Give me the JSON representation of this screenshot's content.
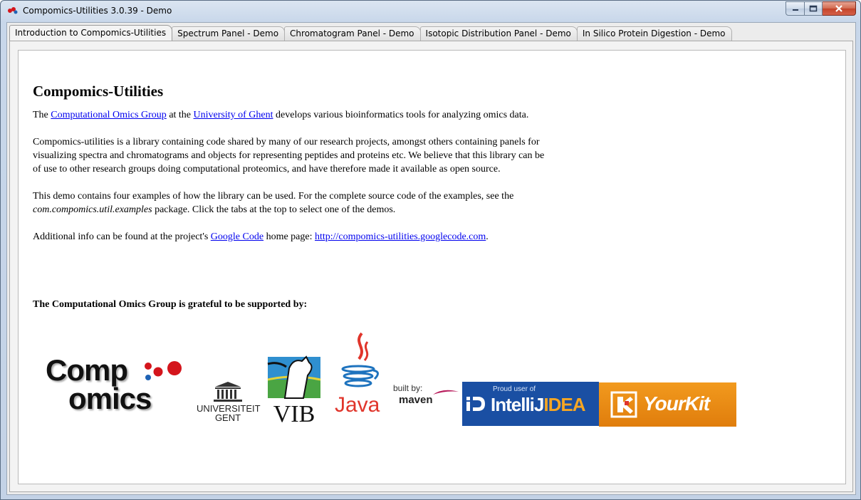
{
  "window": {
    "title": "Compomics-Utilities 3.0.39 - Demo"
  },
  "tabs": [
    {
      "label": "Introduction to Compomics-Utilities",
      "active": true
    },
    {
      "label": "Spectrum Panel - Demo",
      "active": false
    },
    {
      "label": "Chromatogram Panel - Demo",
      "active": false
    },
    {
      "label": "Isotopic Distribution Panel - Demo",
      "active": false
    },
    {
      "label": "In Silico Protein Digestion - Demo",
      "active": false
    }
  ],
  "intro": {
    "heading": "Compomics-Utilities",
    "p1": {
      "t1": "The ",
      "link1": "Computational Omics Group",
      "t2": " at the ",
      "link2": "University of Ghent",
      "t3": " develops various bioinformatics tools for analyzing omics data."
    },
    "p2": "Compomics-utilities is a library containing code shared by many of our research projects, amongst others containing panels for visualizing spectra and chromatograms and objects for representing peptides and proteins etc. We believe that this library can be of use to other research groups doing computational proteomics, and have therefore made it available as open source.",
    "p3": {
      "t1": "This demo contains four examples of how the library can be used. For the complete source code of the examples, see the ",
      "code": "com.compomics.util.examples",
      "t2": " package. Click the tabs at the top to select one of the demos."
    },
    "p4": {
      "t1": "Additional info can be found at the project's ",
      "link1": "Google Code",
      "t2": " home page: ",
      "link2": "http://compomics-utilities.googlecode.com",
      "t3": "."
    }
  },
  "support": {
    "heading": "The Computational Omics Group is grateful to be supported by:",
    "logos": {
      "compomics": {
        "line1": "Comp",
        "line2": "omics"
      },
      "ugent": {
        "line1": "UNIVERSITEIT",
        "line2": "GENT"
      },
      "vib": {
        "text": "VIB"
      },
      "java": {
        "text": "Java"
      },
      "maven": {
        "line1": "built by:",
        "line2": "maven"
      },
      "intellij": {
        "line1": "Proud user of",
        "line2a": "IntelliJ",
        "line2b": "IDEA"
      },
      "yourkit": {
        "text": "YourKit"
      }
    }
  },
  "colors": {
    "link": "#0000ee",
    "compomics_red": "#d4151c",
    "compomics_blue": "#1f63b5",
    "intellij_bg": "#1a4fa3",
    "yourkit_bg": "#f08c1a",
    "java_red": "#e0352b",
    "java_blue": "#1e73be"
  }
}
